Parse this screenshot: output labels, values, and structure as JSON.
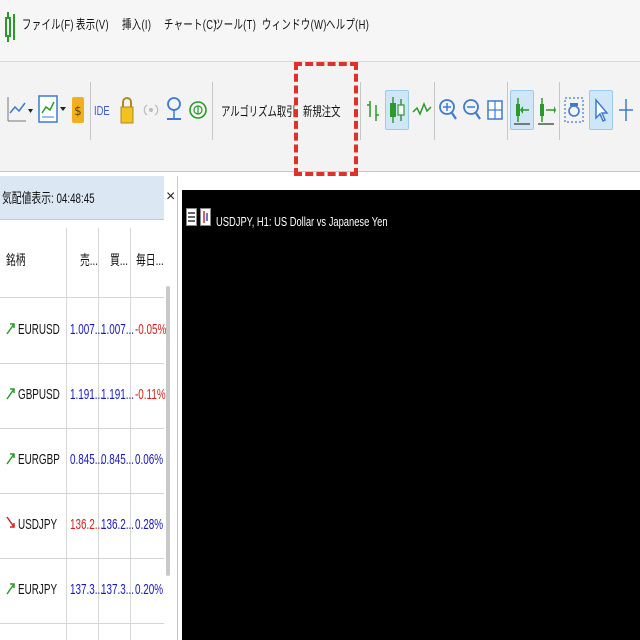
{
  "menu": {
    "items": [
      {
        "label": "ファイル(F)"
      },
      {
        "label": "表示(V)"
      },
      {
        "label": "挿入(I)"
      },
      {
        "label": "チャート(C)"
      },
      {
        "label": "ツール(T)"
      },
      {
        "label": "ウィンドウ(W)"
      },
      {
        "label": "ヘルプ(H)"
      }
    ]
  },
  "toolbar": {
    "algo_label": "アルゴリズム取引",
    "new_order_label": "新規注文",
    "ide_label": "IDE",
    "icons": [
      "line-chart-icon",
      "indicator-icon",
      "dollar-icon",
      "lock-icon",
      "signal-icon",
      "person-icon",
      "globe-icon",
      "stop-icon",
      "new-order-icon",
      "bar-chart-icon",
      "candle-chart-icon",
      "line-wave-icon",
      "zoom-in-icon",
      "zoom-out-icon",
      "grid-icon",
      "autoscroll-icon",
      "chart-shift-icon",
      "screenshot-icon",
      "cursor-icon",
      "crosshair-icon"
    ],
    "accent": "#cfe6f7",
    "highlight_color": "#e0302a"
  },
  "market_watch": {
    "title": "気配値表示: 04:48:45",
    "close_glyph": "×",
    "columns": [
      "銘柄",
      "売...",
      "買...",
      "毎日..."
    ],
    "rows": [
      {
        "symbol": "EURUSD",
        "bid": "1.007...",
        "ask": "1.007...",
        "change": "-0.05%",
        "direction": "up",
        "bid_color": "#1a1ab8",
        "change_color": "#d81e1e"
      },
      {
        "symbol": "GBPUSD",
        "bid": "1.191...",
        "ask": "1.191...",
        "change": "-0.11%",
        "direction": "up",
        "bid_color": "#1a1ab8",
        "change_color": "#d81e1e"
      },
      {
        "symbol": "EURGBP",
        "bid": "0.845...",
        "ask": "0.845...",
        "change": "0.06%",
        "direction": "up",
        "bid_color": "#1a1ab8",
        "change_color": "#1a1ab8"
      },
      {
        "symbol": "USDJPY",
        "bid": "136.2...",
        "ask": "136.2...",
        "change": "0.28%",
        "direction": "down",
        "bid_color": "#d81e1e",
        "change_color": "#1a1ab8"
      },
      {
        "symbol": "EURJPY",
        "bid": "137.3...",
        "ask": "137.3...",
        "change": "0.20%",
        "direction": "up",
        "bid_color": "#1a1ab8",
        "change_color": "#1a1ab8"
      }
    ]
  },
  "chart": {
    "title": "USDJPY, H1: US Dollar vs Japanese Yen",
    "background": "#000000"
  }
}
